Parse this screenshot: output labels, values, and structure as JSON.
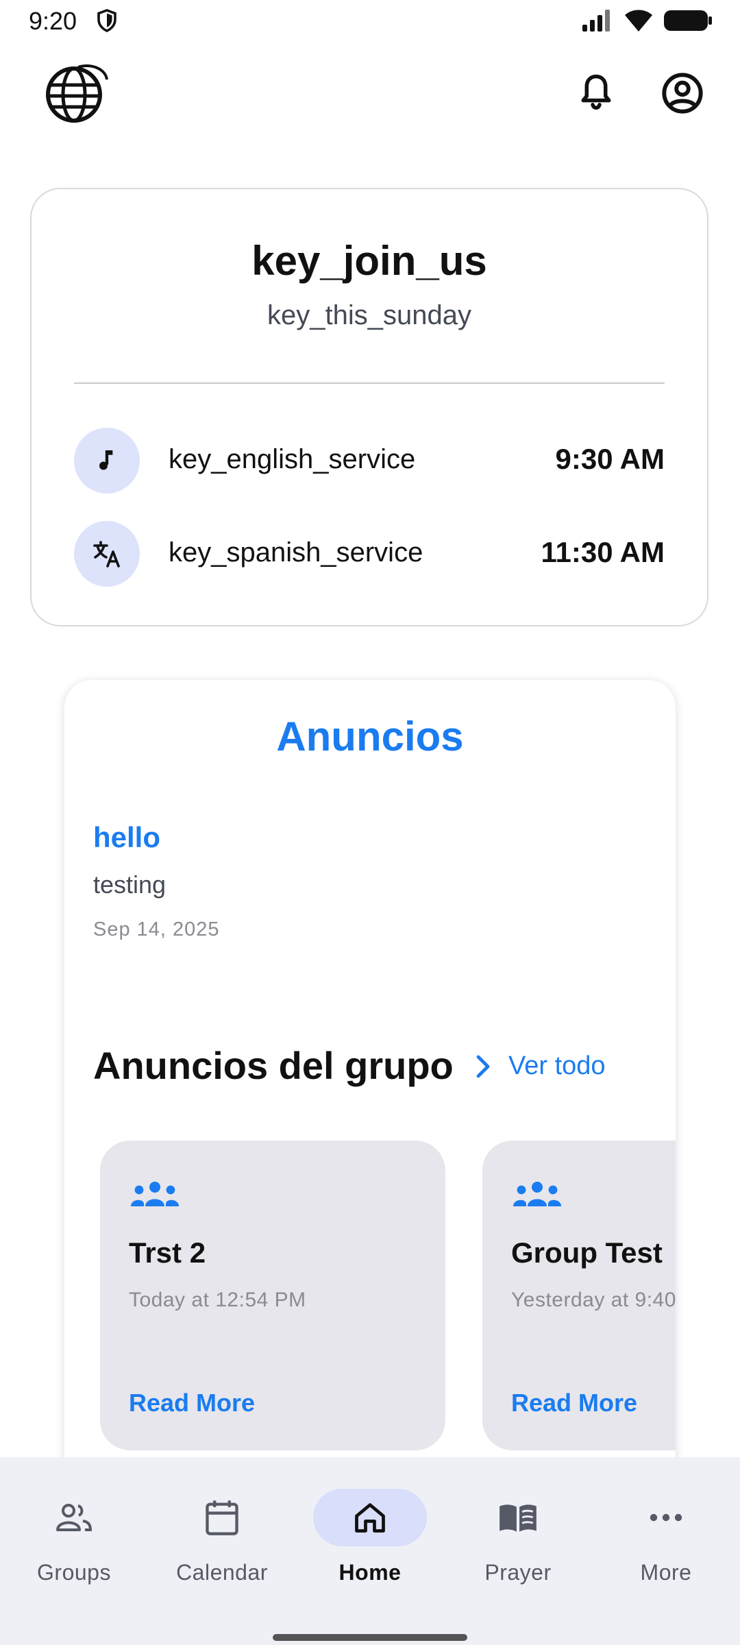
{
  "status_bar": {
    "time": "9:20",
    "icons": [
      "shield-icon",
      "signal-icon",
      "wifi-icon",
      "battery-icon"
    ]
  },
  "app_bar": {
    "logo": "globe-logo",
    "icons": [
      "bell-icon",
      "account-circle-icon"
    ]
  },
  "service_card": {
    "title": "key_join_us",
    "subtitle": "key_this_sunday",
    "services": [
      {
        "icon": "music-note-icon",
        "label": "key_english_service",
        "time": "9:30 AM"
      },
      {
        "icon": "translate-icon",
        "label": "key_spanish_service",
        "time": "11:30 AM"
      }
    ]
  },
  "announcements": {
    "title": "Anuncios",
    "items": [
      {
        "title": "hello",
        "body": "testing",
        "date": "Sep 14, 2025"
      }
    ],
    "group_section": {
      "heading": "Anuncios del grupo",
      "see_all": "Ver todo",
      "cards": [
        {
          "icon": "group-icon",
          "name": "Trst 2",
          "time": "Today at 12:54 PM",
          "action": "Read More"
        },
        {
          "icon": "group-icon",
          "name": "Group Test",
          "time": "Yesterday at 9:40",
          "action": "Read More"
        }
      ]
    }
  },
  "bottom_nav": {
    "items": [
      {
        "label": "Groups",
        "icon": "groups-icon",
        "active": false
      },
      {
        "label": "Calendar",
        "icon": "calendar-icon",
        "active": false
      },
      {
        "label": "Home",
        "icon": "home-icon",
        "active": true
      },
      {
        "label": "Prayer",
        "icon": "book-icon",
        "active": false
      },
      {
        "label": "More",
        "icon": "more-horizontal-icon",
        "active": false
      }
    ]
  },
  "colors": {
    "accent": "#1a7cf0",
    "card_bg": "#e6e6ec",
    "nav_bg": "#eff0f5",
    "active_pill": "#d9defa"
  }
}
